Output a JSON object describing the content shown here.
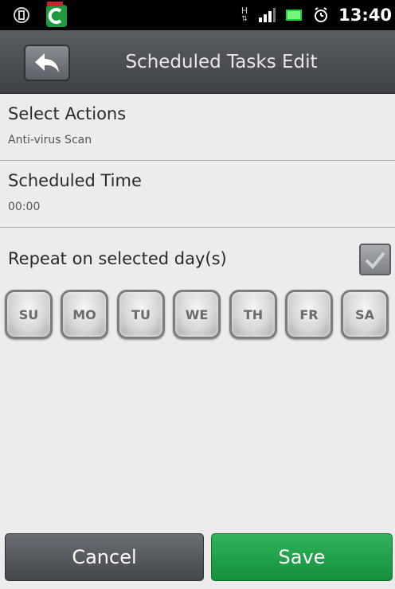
{
  "status_bar": {
    "time": "13:40",
    "network_type": "H",
    "icons": [
      "usb-debug-icon",
      "comodo-app-icon",
      "h-plus-network-icon",
      "signal-icon",
      "battery-icon",
      "alarm-icon"
    ]
  },
  "header": {
    "title": "Scheduled Tasks Edit",
    "back_icon": "back-arrow-icon"
  },
  "rows": {
    "actions": {
      "title": "Select Actions",
      "value": "Anti-virus Scan"
    },
    "time": {
      "title": "Scheduled Time",
      "value": "00:00"
    }
  },
  "repeat": {
    "label": "Repeat on selected day(s)",
    "checked": true
  },
  "days": [
    "SU",
    "MO",
    "TU",
    "WE",
    "TH",
    "FR",
    "SA"
  ],
  "buttons": {
    "cancel": "Cancel",
    "save": "Save"
  },
  "colors": {
    "save": "#1fa048",
    "title_bar": "#4b4e53",
    "background": "#ececec"
  }
}
